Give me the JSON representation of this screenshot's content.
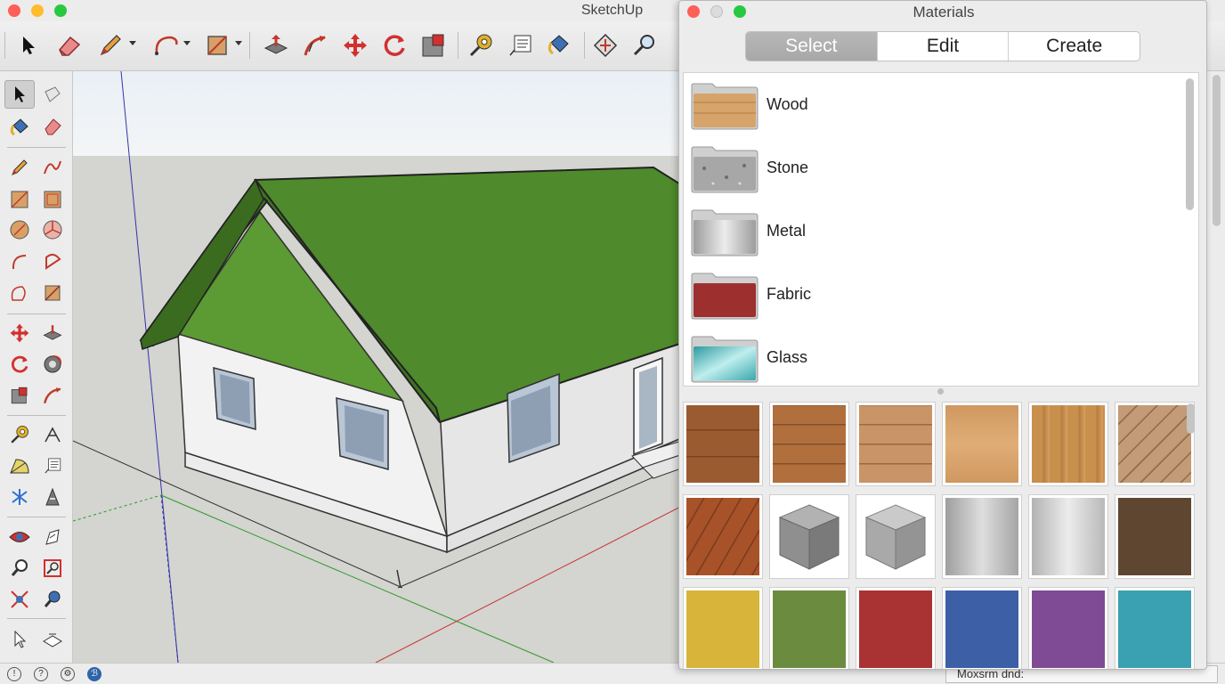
{
  "window": {
    "app_title": "SketchUp",
    "colors": {
      "close": "#fe5f57",
      "minimize": "#febc2e",
      "zoom": "#28c840"
    }
  },
  "toolbar": {
    "items": [
      "select-tool",
      "eraser-tool",
      "pencil-tool",
      "arc-tool",
      "rectangle-tool",
      "push-pull-tool",
      "follow-me-tool",
      "move-tool",
      "rotate-tool",
      "scale-tool",
      "tape-measure-tool",
      "text-tool",
      "paint-bucket-tool",
      "orbit-tool",
      "zoom-tool"
    ]
  },
  "left_toolbar": {
    "items": [
      "select",
      "component",
      "paint-bucket",
      "eraser",
      "line",
      "freehand",
      "rectangle",
      "rotated-rectangle",
      "circle",
      "polygon",
      "arc",
      "pie",
      "2-point-arc",
      "3-point-arc",
      "move",
      "push-pull",
      "rotate",
      "follow-me",
      "scale",
      "offset",
      "tape-measure",
      "dimension",
      "protractor",
      "text",
      "axes",
      "3d-text",
      "orbit",
      "pan",
      "zoom",
      "zoom-window",
      "zoom-extents",
      "position-camera",
      "walk",
      "look-around"
    ]
  },
  "materials_panel": {
    "title": "Materials",
    "tabs": [
      {
        "label": "Select",
        "selected": true
      },
      {
        "label": "Edit",
        "selected": false
      },
      {
        "label": "Create",
        "selected": false
      }
    ],
    "categories": [
      {
        "label": "Wood",
        "color": "#d6a46b"
      },
      {
        "label": "Stone",
        "color": "#a7a7a7"
      },
      {
        "label": "Metal",
        "color": "#c8c8c8"
      },
      {
        "label": "Fabric",
        "color": "#9d2f2f"
      },
      {
        "label": "Glass",
        "color": "#5ec3c4"
      }
    ],
    "swatches": [
      {
        "name": "wood-dark-planks",
        "color": "#9b5b30"
      },
      {
        "name": "wood-medium-planks",
        "color": "#b06f3d"
      },
      {
        "name": "wood-light-planks",
        "color": "#c99466"
      },
      {
        "name": "wood-light-grain",
        "color": "#d39b62"
      },
      {
        "name": "wood-oak",
        "color": "#c98f4d"
      },
      {
        "name": "wood-diagonal",
        "color": "#b78e6a"
      },
      {
        "name": "wood-cherry",
        "color": "#a8522a"
      },
      {
        "name": "stone-granite-dark",
        "color": "#8f8f8f"
      },
      {
        "name": "stone-granite-light",
        "color": "#a9a9a9"
      },
      {
        "name": "metal-brushed-steel",
        "color": "#bdbdbd"
      },
      {
        "name": "metal-aluminum",
        "color": "#c9c9c9"
      },
      {
        "name": "fabric-brown",
        "color": "#5e4631"
      },
      {
        "name": "fabric-yellow",
        "color": "#d8b43b"
      },
      {
        "name": "fabric-green",
        "color": "#6b8c3f"
      },
      {
        "name": "fabric-red",
        "color": "#a93232"
      },
      {
        "name": "fabric-blue",
        "color": "#3c5fa6"
      },
      {
        "name": "fabric-purple",
        "color": "#7f4b94"
      },
      {
        "name": "fabric-teal",
        "color": "#3aa1b2"
      }
    ]
  },
  "statusbar": {
    "measurements_label": "Moxsrm dnd:"
  }
}
